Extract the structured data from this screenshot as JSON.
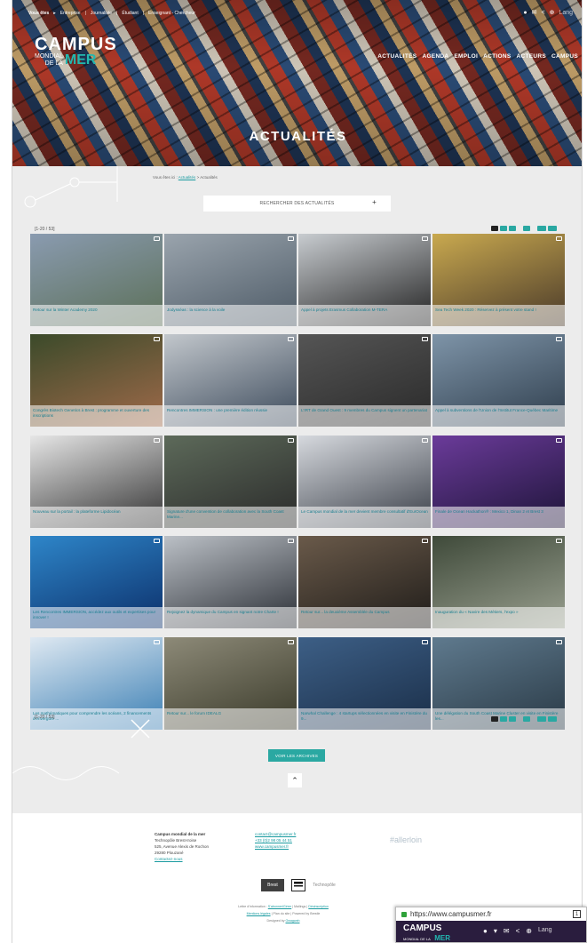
{
  "topbar": {
    "lead": "Vous êtes",
    "lead_arrow": "▸",
    "items": [
      "Entreprise",
      "Journaliste",
      "Étudiant",
      "Enseignant - Chercheur"
    ],
    "lang": "Lang"
  },
  "logo": {
    "line1": "CAMPUS",
    "mondial": "MONDIAL",
    "de_la": "DE LA",
    "mer": "MER"
  },
  "nav": [
    "ACTUALITÉS",
    "AGENDA",
    "EMPLOI",
    "ACTIONS",
    "ACTEURS",
    "CAMPUS"
  ],
  "hero_title": "ACTUALITÉS",
  "breadcrumb": {
    "prefix": "Vous êtes ici :",
    "link": "Actualités",
    "sep": ">",
    "current": "Actualités"
  },
  "search_toggle": {
    "label": "RECHERCHER DES ACTUALITÉS",
    "plus": "+"
  },
  "count_top": "[1-20 / 53]",
  "count_bottom": "[1-20 / 53]",
  "news": [
    {
      "title": "Retour sur la Winter Academy 2020",
      "colors": [
        "#8a9bb0",
        "#5b6f57"
      ]
    },
    {
      "title": "Jodysséas : la science à la voile",
      "colors": [
        "#9aa4ad",
        "#4d5a66"
      ]
    },
    {
      "title": "Appel à projets Erasmus Collaboration M-TERA",
      "colors": [
        "#c8ccd0",
        "#222"
      ]
    },
    {
      "title": "Sea Tech Week 2020 : Réservez à présent votre stand !",
      "colors": [
        "#c9a94f",
        "#4a3a2a"
      ]
    },
    {
      "title": "Congrès Biotech Genetics à Brest : programme et ouverture des inscriptions",
      "colors": [
        "#3b4a2a",
        "#a06a4a"
      ]
    },
    {
      "title": "Rencontres IMMERSION : une première édition réussie",
      "colors": [
        "#c2c7cc",
        "#3d4b5c"
      ]
    },
    {
      "title": "L'IRT de Grand Ouest : 9 membres du Campus signent un partenariat",
      "colors": [
        "#555",
        "#2a2a2a"
      ]
    },
    {
      "title": "Appel à subventions de l'Union de l'Institut France-Québec Maritime",
      "colors": [
        "#7e94a8",
        "#2f3e4d"
      ]
    },
    {
      "title": "Nouveau sur la portail : la plateforme Lipidocéan",
      "colors": [
        "#e6e6e6",
        "#333"
      ]
    },
    {
      "title": "Signature d'une convention de collaboration avec la South Coast Marine...",
      "colors": [
        "#5d6a5a",
        "#2a2a2a"
      ]
    },
    {
      "title": "Le Campus mondial de la mer devient membre consultatif d'EurOcean",
      "colors": [
        "#d6d9de",
        "#3a3f48"
      ]
    },
    {
      "title": "Finale de Ocean Hackathon® : Mexico 1, Dinan 2 et Brest 3",
      "colors": [
        "#6b3b9a",
        "#1d1438"
      ]
    },
    {
      "title": "Les Rencontres IMMERSION, accédez aux outils et expertises pour innover !",
      "colors": [
        "#2e86c9",
        "#0c2f6a"
      ]
    },
    {
      "title": "Rejoignez la dynamique du Campus en signant notre Charte !",
      "colors": [
        "#bbc0c6",
        "#2b2f36"
      ]
    },
    {
      "title": "Retour sur... la deuxième Assemblée du Campus",
      "colors": [
        "#6a5a4a",
        "#1f1c19"
      ]
    },
    {
      "title": "Inauguration du « Navire des Métiers, l'expo »",
      "colors": [
        "#3f4a3a",
        "#9aa090"
      ]
    },
    {
      "title": "Les mathématiques pour comprendre les océans, 2 financements d'envergure ...",
      "colors": [
        "#dfe9f2",
        "#3b7fb4"
      ]
    },
    {
      "title": "Retour sur... le forum IDEALG",
      "colors": [
        "#8d8a78",
        "#3a3a2a"
      ]
    },
    {
      "title": "Narwhal Challenge : 4 startups sélectionnées en visite en Finistère du 9...",
      "colors": [
        "#3d5f86",
        "#1a2e48"
      ]
    },
    {
      "title": "Une délégation du South Coast Marine Cluster en visite en Finistère les...",
      "colors": [
        "#5f7a8e",
        "#2a3a46"
      ]
    }
  ],
  "archives_label": "VOIR LES ARCHIVES",
  "up_arrow": "⌃",
  "footer": {
    "org": "Campus mondial de la mer",
    "addr1": "Technopôle Brest-Iroise",
    "addr2": "525, Avenue Alexis de Rochon",
    "addr3": "29280 Plouzané",
    "contact_link": "Contactez-nous",
    "email": "contact@campusmer.fr",
    "phone": "+33 (0)2 98 05 44 51",
    "site": "www.campusmer.fr",
    "hashtag": "#allerloin",
    "logos": [
      "Brest",
      "Région Bretagne",
      "Technopôle"
    ],
    "line1": "Lettre d'information :",
    "line1_links": [
      "S'abonner/Gérer",
      "Mailings",
      "Désinscription"
    ],
    "line2_links": [
      "Mentions légales",
      "Plan du site",
      "Powered by Brestle"
    ],
    "line3": "Designed by",
    "line3_link": "Gwagwah"
  },
  "mobile": {
    "url": "https://www.campusmer.fr",
    "tabs": "1",
    "logo_main": "CAMPUS",
    "logo_small": "MONDIAL DE LA",
    "logo_mer": "MER",
    "lang": "Lang"
  }
}
